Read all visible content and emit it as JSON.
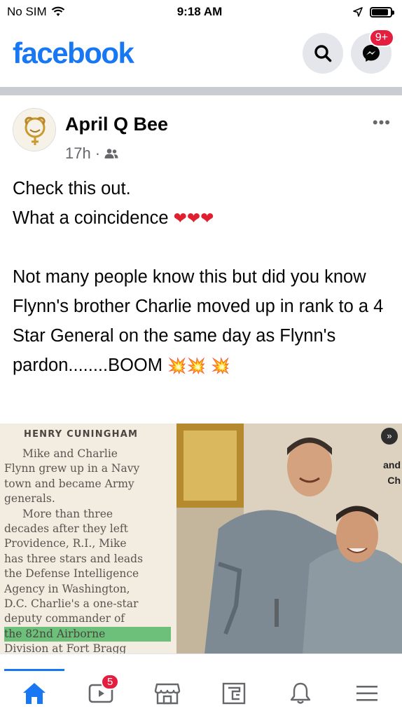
{
  "status_bar": {
    "carrier": "No SIM",
    "time": "9:18 AM",
    "battery_level": 0.9
  },
  "header": {
    "logo": "facebook",
    "search_icon": "search-icon",
    "messenger_icon": "messenger-icon",
    "messenger_badge": "9+"
  },
  "post": {
    "author": "April Q Bee",
    "time_ago": "17h",
    "separator": "·",
    "audience_icon": "friends-icon",
    "more": "•••",
    "text_line1": "Check this out.",
    "text_line2": "What a coincidence",
    "hearts": "❤❤❤",
    "paragraph": "Not many people know this but did you know Flynn's brother Charlie moved up in rank to a 4 Star General on the same day as Flynn's pardon........BOOM",
    "boom_inline": "💥💥",
    "boom_trailing": "💥",
    "image": {
      "clipping_heading": "HENRY CUNINGHAM",
      "clipping_lines": [
        "Mike and Charlie",
        "Flynn grew up in a Navy",
        "town and became Army",
        "generals.",
        "More than three",
        "decades after they left",
        "Providence, R.I., Mike",
        "has three stars and leads",
        "the Defense Intelligence",
        "Agency in Washington,",
        "D.C. Charlie's a one-star",
        "deputy commander of",
        "the 82nd Airborne",
        "Division at Fort Bragg"
      ],
      "side_text_1": "and",
      "side_text_2": "Ch",
      "next_icon": "next-arrow-icon"
    }
  },
  "bottom_nav": {
    "items": [
      {
        "name": "home",
        "icon": "home-icon",
        "active": true
      },
      {
        "name": "watch",
        "icon": "video-icon",
        "badge": "5"
      },
      {
        "name": "marketplace",
        "icon": "store-icon"
      },
      {
        "name": "pages",
        "icon": "pages-icon"
      },
      {
        "name": "notifications",
        "icon": "bell-icon"
      },
      {
        "name": "menu",
        "icon": "menu-icon"
      }
    ],
    "watch_badge": "5"
  },
  "colors": {
    "brand": "#1877f2",
    "badge": "#e41e3f",
    "secondary_text": "#65676b"
  }
}
